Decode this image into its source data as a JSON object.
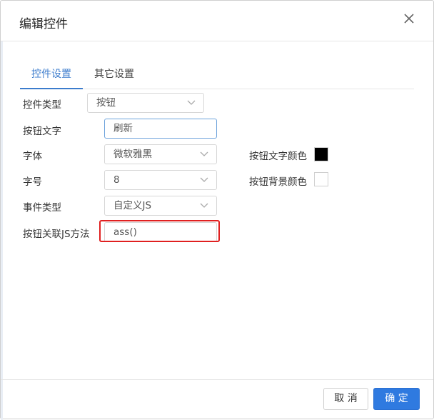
{
  "dialog": {
    "title": "编辑控件",
    "close_icon": "close-icon"
  },
  "tabs": [
    {
      "label": "控件设置",
      "active": true
    },
    {
      "label": "其它设置",
      "active": false
    }
  ],
  "form": {
    "control_type": {
      "label": "控件类型",
      "value": "按钮"
    },
    "button_text": {
      "label": "按钮文字",
      "value": "刷新"
    },
    "font": {
      "label": "字体",
      "value": "微软雅黑"
    },
    "font_size": {
      "label": "字号",
      "value": "8"
    },
    "event_type": {
      "label": "事件类型",
      "value": "自定义JS"
    },
    "js_method": {
      "label": "按钮关联JS方法",
      "value": "ass()"
    },
    "text_color": {
      "label": "按钮文字颜色",
      "color": "#000000"
    },
    "bg_color": {
      "label": "按钮背景颜色",
      "color": "#ffffff"
    }
  },
  "footer": {
    "cancel_label": "取 消",
    "ok_label": "确 定"
  },
  "colors": {
    "accent": "#3c7ccd",
    "primary_button": "#2f7ae0",
    "highlight": "#e02020"
  }
}
